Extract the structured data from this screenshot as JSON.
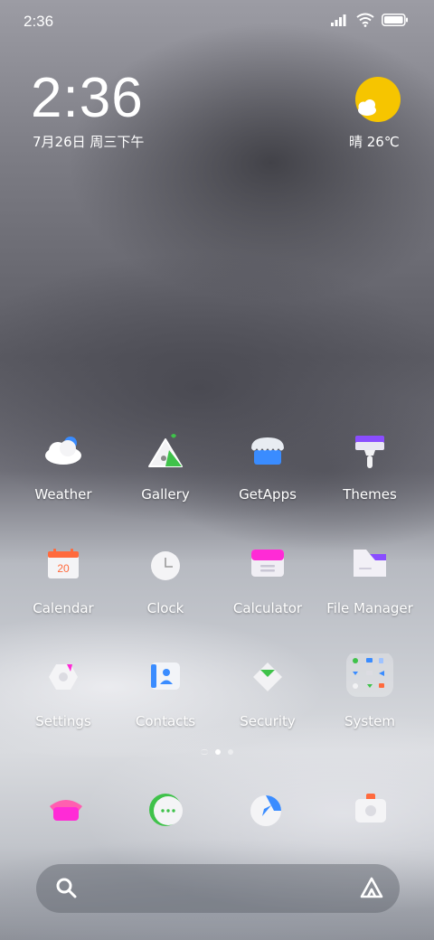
{
  "status": {
    "time": "2:36"
  },
  "widget": {
    "time": "2:36",
    "date": "7月26日 周三下午",
    "weather": "晴 26℃"
  },
  "apps": [
    {
      "label": "Weather",
      "icon": "weather-icon"
    },
    {
      "label": "Gallery",
      "icon": "gallery-icon"
    },
    {
      "label": "GetApps",
      "icon": "getapps-icon"
    },
    {
      "label": "Themes",
      "icon": "themes-icon"
    },
    {
      "label": "Calendar",
      "icon": "calendar-icon",
      "day": "20"
    },
    {
      "label": "Clock",
      "icon": "clock-icon"
    },
    {
      "label": "Calculator",
      "icon": "calculator-icon"
    },
    {
      "label": "File Manager",
      "icon": "file-manager-icon"
    },
    {
      "label": "Settings",
      "icon": "settings-icon"
    },
    {
      "label": "Contacts",
      "icon": "contacts-icon"
    },
    {
      "label": "Security",
      "icon": "security-icon"
    },
    {
      "label": "System",
      "icon": "system-folder-icon"
    }
  ],
  "dock": [
    {
      "icon": "phone-icon"
    },
    {
      "icon": "messages-icon"
    },
    {
      "icon": "browser-icon"
    },
    {
      "icon": "camera-icon"
    }
  ],
  "colors": {
    "sun": "#f6c500",
    "accent_blue": "#3a8cff",
    "accent_green": "#3fc24a",
    "accent_pink": "#ff2bd6",
    "accent_orange": "#ff6a3d"
  }
}
